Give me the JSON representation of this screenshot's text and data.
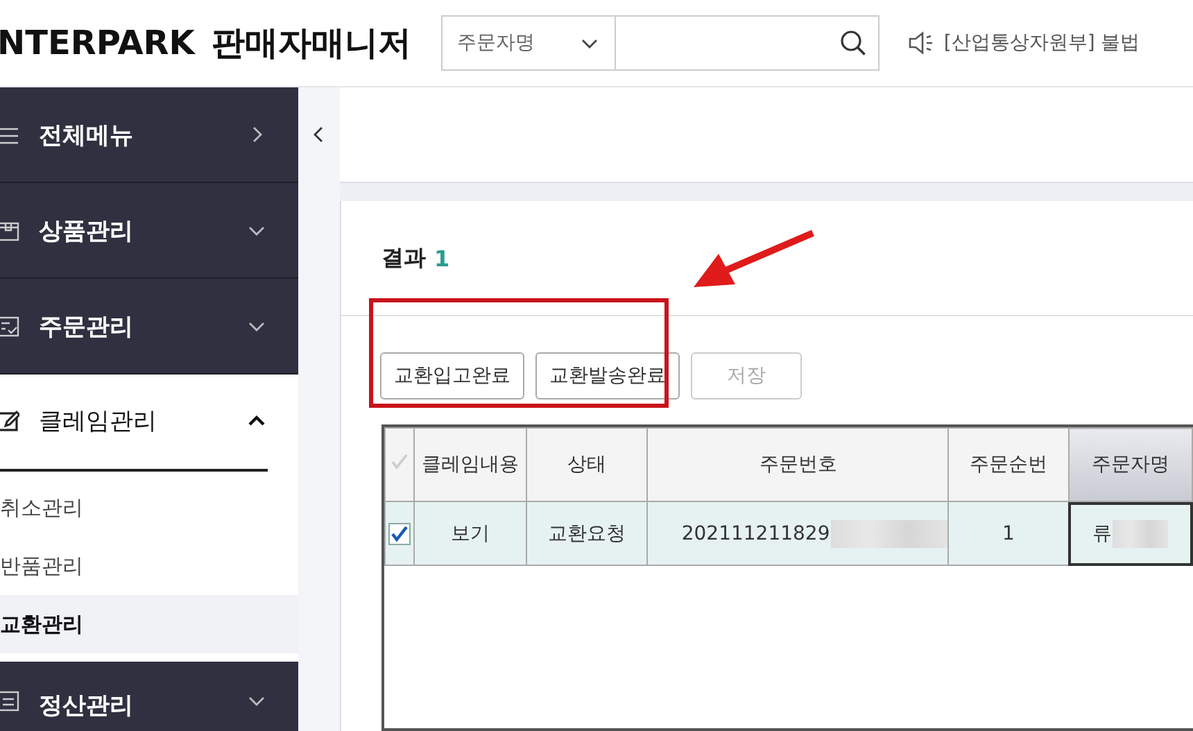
{
  "header": {
    "logo": "NTERPARK",
    "title": "판매자매니저",
    "search": {
      "select": "주문자명"
    },
    "notice": "[산업통상자원부] 불법"
  },
  "sidebar": {
    "items": [
      {
        "label": "전체메뉴",
        "expanded": false,
        "kind": "link"
      },
      {
        "label": "상품관리",
        "expanded": false,
        "kind": "group"
      },
      {
        "label": "주문관리",
        "expanded": false,
        "kind": "group"
      },
      {
        "label": "클레임관리",
        "expanded": true,
        "kind": "group",
        "children": [
          {
            "label": "취소관리",
            "selected": false
          },
          {
            "label": "반품관리",
            "selected": false
          },
          {
            "label": "교환관리",
            "selected": true
          }
        ]
      },
      {
        "label": "정산관리",
        "expanded": false,
        "kind": "group"
      }
    ]
  },
  "result": {
    "label": "결과",
    "count": "1"
  },
  "buttons": [
    {
      "label": "교환입고완료",
      "disabled": false
    },
    {
      "label": "교환발송완료",
      "disabled": false
    },
    {
      "label": "저장",
      "disabled": true
    }
  ],
  "table": {
    "columns": [
      {
        "label": "클레임내용",
        "selected": false
      },
      {
        "label": "상태",
        "selected": false
      },
      {
        "label": "주문번호",
        "selected": false
      },
      {
        "label": "주문순번",
        "selected": false
      },
      {
        "label": "주문자명",
        "selected": true
      }
    ],
    "rows": [
      {
        "checked": true,
        "cells": [
          "보기",
          "교환요청",
          "202111211829",
          "1",
          "류"
        ],
        "redacted": [
          false,
          false,
          true,
          false,
          true
        ]
      }
    ]
  }
}
